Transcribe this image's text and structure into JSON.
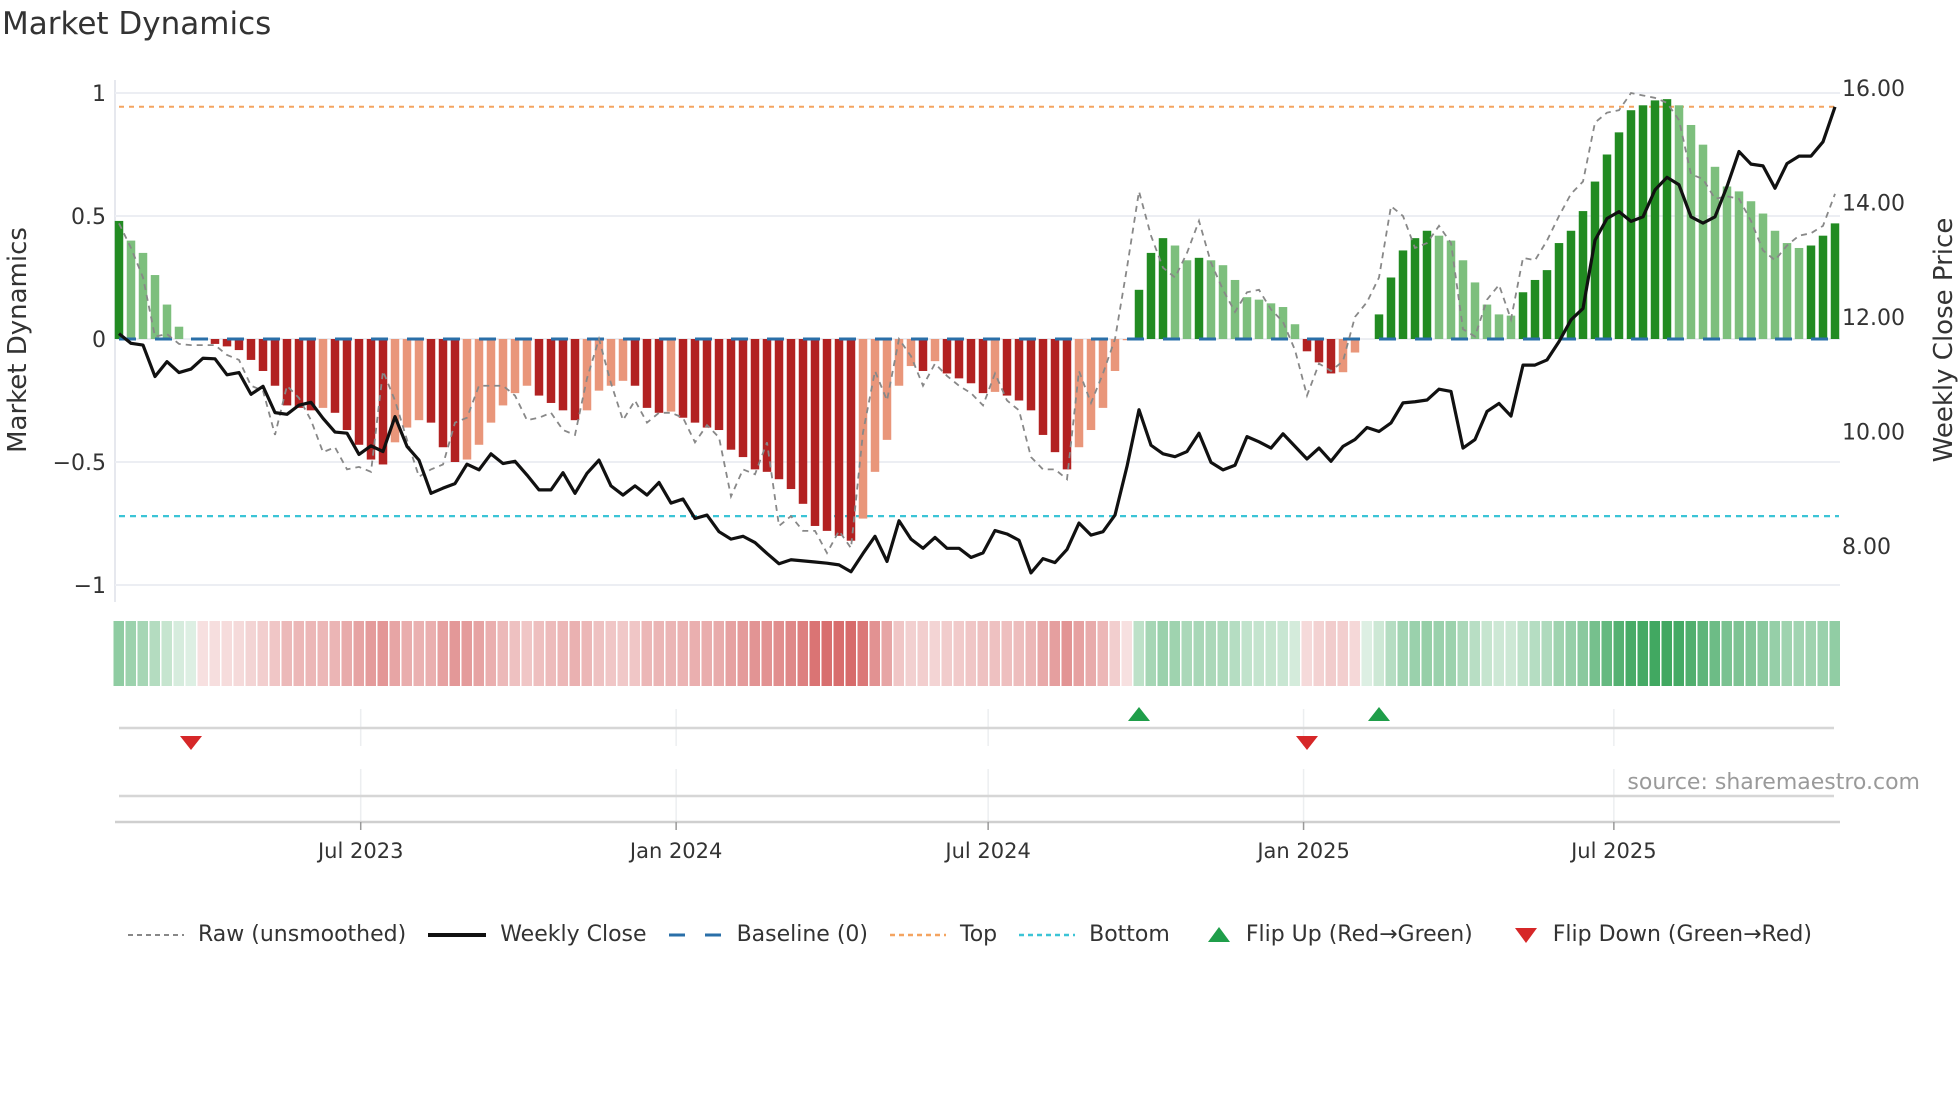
{
  "title": "Market Dynamics",
  "source": "source: sharemaestro.com",
  "colors": {
    "up_strong": "#228b22",
    "up_weak": "#7dbf7d",
    "down_strong": "#b22222",
    "down_weak": "#e9967a",
    "strip_green": "26,150,65",
    "strip_red": "200,50,50",
    "raw": "#888888",
    "close": "#111111",
    "baseline": "#2a6fa8",
    "top": "#f4a460",
    "bottom": "#3bc4d6",
    "flip_up": "#1f9e4a",
    "flip_down": "#d62728"
  },
  "legend": {
    "raw": "Raw (unsmoothed)",
    "close": "Weekly Close",
    "baseline": "Baseline (0)",
    "top": "Top",
    "bottom": "Bottom",
    "flip_up": "Flip Up (Red→Green)",
    "flip_down": "Flip Down (Green→Red)"
  },
  "chart_data": {
    "type": "bar",
    "title": "Market Dynamics",
    "ylabel": "Market Dynamics",
    "y2label": "Weekly Close Price",
    "ylim": [
      -1,
      1
    ],
    "y2lim": [
      7.0,
      16.3
    ],
    "yticks": [
      {
        "v": 1,
        "label": "1"
      },
      {
        "v": 0.5,
        "label": "0.5"
      },
      {
        "v": 0,
        "label": "0"
      },
      {
        "v": -0.5,
        "label": "−0.5"
      },
      {
        "v": -1,
        "label": "−1"
      }
    ],
    "y2ticks": [
      {
        "v": 16,
        "label": "16.00"
      },
      {
        "v": 14,
        "label": "14.00"
      },
      {
        "v": 12,
        "label": "12.00"
      },
      {
        "v": 10,
        "label": "10.00"
      },
      {
        "v": 8,
        "label": "8.00"
      }
    ],
    "xticks": [
      {
        "date": "2023-07-01",
        "label": "Jul 2023"
      },
      {
        "date": "2024-01-01",
        "label": "Jan 2024"
      },
      {
        "date": "2024-07-01",
        "label": "Jul 2024"
      },
      {
        "date": "2025-01-01",
        "label": "Jan 2025"
      },
      {
        "date": "2025-07-01",
        "label": "Jul 2025"
      }
    ],
    "start_date": "2023-02-10",
    "frequency": "weekly",
    "top_level": 0.944,
    "bottom_level": -0.72,
    "baseline": 0,
    "grid": true,
    "legend_position": "bottom",
    "dynamics": [
      0.48,
      0.4,
      0.35,
      0.26,
      0.14,
      0.05,
      0.0,
      -0.005,
      -0.02,
      -0.03,
      -0.045,
      -0.085,
      -0.13,
      -0.19,
      -0.27,
      -0.28,
      -0.29,
      -0.28,
      -0.3,
      -0.37,
      -0.43,
      -0.49,
      -0.51,
      -0.42,
      -0.36,
      -0.33,
      -0.34,
      -0.44,
      -0.5,
      -0.49,
      -0.43,
      -0.34,
      -0.27,
      -0.22,
      -0.19,
      -0.23,
      -0.26,
      -0.29,
      -0.33,
      -0.29,
      -0.21,
      -0.19,
      -0.17,
      -0.19,
      -0.28,
      -0.3,
      -0.295,
      -0.32,
      -0.34,
      -0.36,
      -0.37,
      -0.45,
      -0.48,
      -0.53,
      -0.54,
      -0.57,
      -0.61,
      -0.67,
      -0.76,
      -0.78,
      -0.8,
      -0.82,
      -0.73,
      -0.54,
      -0.41,
      -0.19,
      -0.11,
      -0.13,
      -0.09,
      -0.14,
      -0.16,
      -0.18,
      -0.22,
      -0.215,
      -0.23,
      -0.25,
      -0.29,
      -0.39,
      -0.46,
      -0.53,
      -0.44,
      -0.37,
      -0.28,
      -0.13,
      -0.005,
      0.2,
      0.35,
      0.41,
      0.38,
      0.32,
      0.33,
      0.32,
      0.3,
      0.24,
      0.17,
      0.16,
      0.145,
      0.13,
      0.06,
      -0.05,
      -0.095,
      -0.14,
      -0.135,
      -0.055,
      0.0,
      0.1,
      0.25,
      0.36,
      0.41,
      0.44,
      0.42,
      0.4,
      0.32,
      0.23,
      0.14,
      0.1,
      0.095,
      0.19,
      0.24,
      0.28,
      0.39,
      0.44,
      0.52,
      0.64,
      0.75,
      0.84,
      0.93,
      0.95,
      0.97,
      0.975,
      0.95,
      0.87,
      0.79,
      0.7,
      0.62,
      0.6,
      0.56,
      0.51,
      0.44,
      0.39,
      0.37,
      0.38,
      0.42,
      0.47
    ],
    "raw": [
      0.47,
      0.37,
      0.25,
      0.01,
      0.02,
      -0.02,
      -0.025,
      -0.025,
      -0.025,
      -0.065,
      -0.085,
      -0.19,
      -0.21,
      -0.39,
      -0.19,
      -0.24,
      -0.33,
      -0.46,
      -0.44,
      -0.53,
      -0.52,
      -0.54,
      -0.13,
      -0.25,
      -0.41,
      -0.56,
      -0.53,
      -0.51,
      -0.34,
      -0.32,
      -0.19,
      -0.19,
      -0.19,
      -0.23,
      -0.33,
      -0.32,
      -0.3,
      -0.37,
      -0.39,
      -0.16,
      0.0,
      -0.18,
      -0.33,
      -0.25,
      -0.34,
      -0.3,
      -0.3,
      -0.32,
      -0.42,
      -0.35,
      -0.4,
      -0.64,
      -0.53,
      -0.55,
      -0.42,
      -0.76,
      -0.72,
      -0.78,
      -0.78,
      -0.87,
      -0.78,
      -0.85,
      -0.38,
      -0.13,
      -0.25,
      0.0,
      -0.07,
      -0.19,
      -0.1,
      -0.15,
      -0.19,
      -0.22,
      -0.27,
      -0.14,
      -0.25,
      -0.29,
      -0.48,
      -0.53,
      -0.53,
      -0.57,
      -0.13,
      -0.26,
      -0.14,
      0.0,
      0.29,
      0.6,
      0.42,
      0.29,
      0.25,
      0.35,
      0.48,
      0.31,
      0.2,
      0.11,
      0.19,
      0.2,
      0.12,
      0.07,
      -0.045,
      -0.23,
      -0.1,
      -0.13,
      -0.09,
      0.09,
      0.15,
      0.25,
      0.54,
      0.5,
      0.37,
      0.39,
      0.46,
      0.39,
      0.04,
      0.01,
      0.16,
      0.22,
      0.08,
      0.33,
      0.32,
      0.4,
      0.5,
      0.59,
      0.64,
      0.88,
      0.92,
      0.93,
      1.0,
      0.99,
      0.98,
      0.96,
      0.89,
      0.67,
      0.65,
      0.57,
      0.58,
      0.57,
      0.48,
      0.36,
      0.32,
      0.38,
      0.42,
      0.43,
      0.46,
      0.59
    ],
    "close": [
      11.71,
      11.54,
      11.51,
      10.96,
      11.22,
      11.03,
      11.09,
      11.28,
      11.27,
      10.99,
      11.03,
      10.65,
      10.79,
      10.33,
      10.3,
      10.46,
      10.51,
      10.23,
      9.99,
      9.97,
      9.6,
      9.75,
      9.65,
      10.26,
      9.74,
      9.5,
      8.92,
      9.01,
      9.09,
      9.43,
      9.33,
      9.61,
      9.44,
      9.48,
      9.24,
      8.98,
      8.98,
      9.28,
      8.92,
      9.27,
      9.5,
      9.05,
      8.89,
      9.05,
      8.89,
      9.11,
      8.75,
      8.82,
      8.48,
      8.54,
      8.25,
      8.12,
      8.17,
      8.06,
      7.87,
      7.69,
      7.76,
      7.74,
      7.72,
      7.7,
      7.67,
      7.55,
      7.87,
      8.17,
      7.73,
      8.44,
      8.12,
      7.96,
      8.15,
      7.96,
      7.96,
      7.8,
      7.88,
      8.27,
      8.21,
      8.1,
      7.53,
      7.78,
      7.71,
      7.94,
      8.4,
      8.19,
      8.25,
      8.54,
      9.39,
      10.38,
      9.76,
      9.61,
      9.56,
      9.65,
      9.97,
      9.46,
      9.33,
      9.41,
      9.91,
      9.82,
      9.71,
      9.96,
      9.74,
      9.52,
      9.71,
      9.48,
      9.74,
      9.86,
      10.07,
      10.0,
      10.15,
      10.5,
      10.52,
      10.55,
      10.74,
      10.7,
      9.71,
      9.86,
      10.35,
      10.49,
      10.27,
      11.16,
      11.16,
      11.25,
      11.57,
      11.95,
      12.15,
      13.34,
      13.72,
      13.84,
      13.67,
      13.75,
      14.22,
      14.44,
      14.31,
      13.75,
      13.64,
      13.75,
      14.28,
      14.89,
      14.67,
      14.64,
      14.25,
      14.68,
      14.81,
      14.81,
      15.06,
      15.67
    ],
    "flip_up_weeks": [
      85,
      105
    ],
    "flip_down_weeks": [
      6,
      99
    ]
  }
}
